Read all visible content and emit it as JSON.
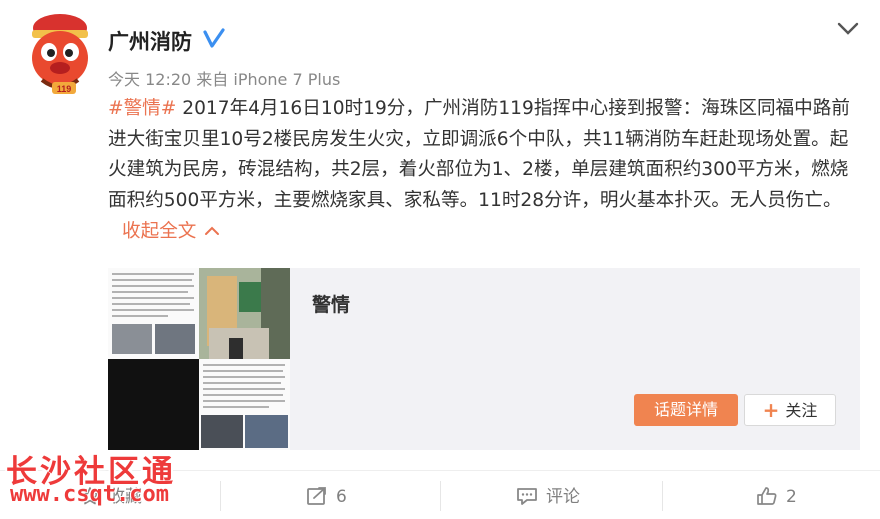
{
  "post": {
    "username": "广州消防",
    "timestamp": "今天 12:20",
    "source": "来自 iPhone 7 Plus",
    "hashtag": "#警情#",
    "body": " 2017年4月16日10时19分，广州消防119指挥中心接到报警：海珠区同福中路前进大街宝贝里10号2楼民房发生火灾，立即调派6个中队，共11辆消防车赶赴现场处置。起火建筑为民房，砖混结构，共2层，着火部位为1、2楼，单层建筑面积约300平方米，燃烧面积约500平方米，主要燃烧家具、家私等。11时28分许，明火基本扑灭。无人员伤亡。",
    "collapse_label": "收起全文"
  },
  "card": {
    "title": "警情",
    "topic_button": "话题详情",
    "follow_button": "关注"
  },
  "actions": {
    "collect": "收藏",
    "repost_count": "6",
    "comment_label": "评论",
    "like_count": "2"
  },
  "watermark": {
    "text": "长沙社区通",
    "url": "www.csqt.com"
  },
  "colors": {
    "accent": "#eb7350",
    "topic_button_bg": "#f08450",
    "verified": "#3b8ff0"
  }
}
